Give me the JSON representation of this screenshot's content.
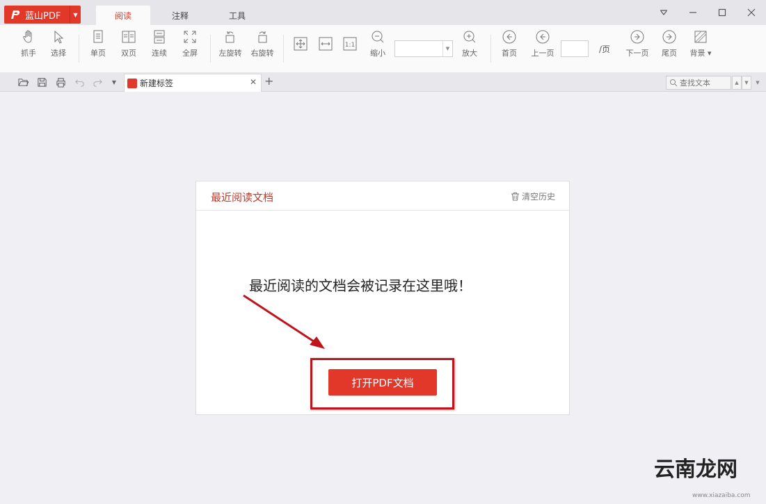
{
  "app": {
    "logo_label": "蓝山PDF"
  },
  "menu_tabs": [
    {
      "label": "阅读",
      "active": true
    },
    {
      "label": "注释",
      "active": false
    },
    {
      "label": "工具",
      "active": false
    }
  ],
  "toolbar": {
    "grab": "抓手",
    "select": "选择",
    "single_page": "单页",
    "double_page": "双页",
    "continuous": "连续",
    "fullscreen": "全屏",
    "rotate_left": "左旋转",
    "rotate_right": "右旋转",
    "zoom_out": "缩小",
    "zoom_value": "",
    "zoom_in": "放大",
    "first_page": "首页",
    "prev_page": "上一页",
    "page_value": "",
    "page_suffix": "/页",
    "next_page": "下一页",
    "last_page": "尾页",
    "background": "背景"
  },
  "tabbar": {
    "doc_tab_label": "新建标签",
    "search_placeholder": "查找文本"
  },
  "panel": {
    "title": "最近阅读文档",
    "clear_history": "清空历史",
    "empty_message": "最近阅读的文档会被记录在这里哦！",
    "open_button": "打开PDF文档"
  },
  "watermark": {
    "text": "云南龙网",
    "subtext": "www.xiazaiba.com"
  },
  "colors": {
    "accent": "#e2382a",
    "highlight": "#c0141c"
  },
  "icons": [
    "hand-icon",
    "cursor-icon",
    "single-page-icon",
    "double-page-icon",
    "continuous-icon",
    "fullscreen-icon",
    "rotate-left-icon",
    "rotate-right-icon",
    "fit-page-icon",
    "fit-width-icon",
    "actual-size-icon",
    "zoom-out-icon",
    "zoom-in-icon",
    "first-page-icon",
    "prev-page-icon",
    "next-page-icon",
    "last-page-icon",
    "background-icon",
    "folder-open-icon",
    "save-icon",
    "print-icon",
    "undo-icon",
    "redo-icon",
    "search-icon",
    "trash-icon"
  ]
}
